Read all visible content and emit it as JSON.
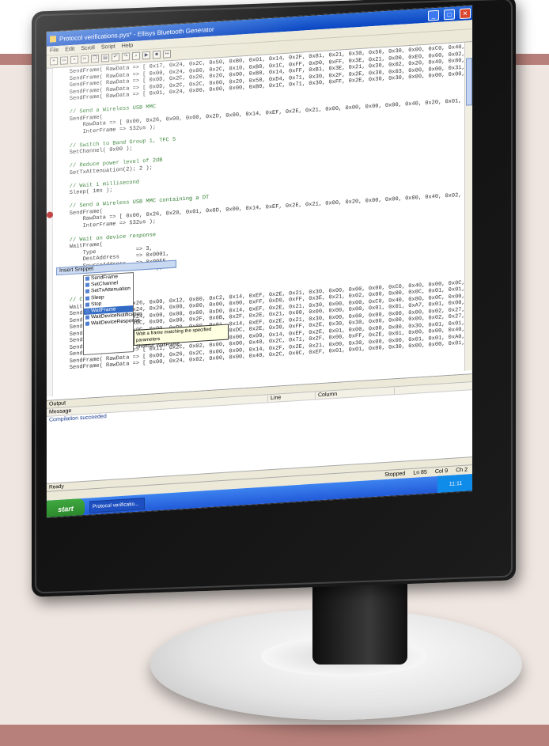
{
  "window": {
    "title": "Protocol verifications.pys* - Ellisys Bluetooth Generator",
    "min_symbol": "_",
    "max_symbol": "□",
    "close_symbol": "✕"
  },
  "menu": [
    "File",
    "Edit",
    "Scroll",
    "Script",
    "Help"
  ],
  "toolbar_icons": [
    "new-icon",
    "open-icon",
    "save-icon",
    "cut-icon",
    "copy-icon",
    "paste-icon",
    "undo-icon",
    "redo-icon",
    "find-icon",
    "run-icon",
    "stop-icon",
    "step-icon"
  ],
  "code_lines": [
    "    SendFrame( RawData => [ 0x17, 0x24, 0x2C, 0x50, 0xB0, 0x01, 0x14, 0x2F, 0x81, 0x21, 0x30, 0x50, 0x30, 0x00, 0xC0, 0x40, 0x00, 0x00, 0x00, 0xC0,",
    "    SendFrame( RawData => [ 0x00, 0x24, 0x00, 0x2C, 0x10, 0xB0, 0x1C, 0xFF, 0xD0, 0xFF, 0x3E, 0x21, 0xD0, 0xE0, 0x60, 0x02, 0x01, 0x01, 0xA7, 0x02, 0x00,",
    "    SendFrame( RawData => [ 0x0D, 0x2C, 0x20, 0x20, 0x00, 0xB0, 0x14, 0xFF, 0xB1, 0x3E, 0x21, 0x30, 0x02, 0x20, 0x40, 0x80, 0x00, 0x02, 0x27, 0x00,",
    "    SendFrame( RawData => [ 0x0D, 0x2C, 0x2C, 0x00, 0x20, 0x50, 0xD4, 0x71, 0x30, 0x2F, 0x2E, 0x30, 0x03, 0x00, 0x00, 0x31, 0x01, 0x5C, 0x02, 0x00,",
    "    SendFrame( RawData => [ 0x01, 0x24, 0x00, 0x00, 0x00, 0xB0, 0x1C, 0x71, 0x30, 0xFF, 0x2E, 0x30, 0x30, 0x00, 0x00, 0x00,",
    "",
    "    // Send a Wireless USB MMC",
    "    SendFrame(",
    "        RawData => [ 0x00, 0x26, 0x00, 0x00, 0x2D, 0x00, 0x14, 0xEF, 0x2E, 0x21, 0x00, 0x00, 0x00, 0x00, 0x40, 0x20, 0x01, 0x0C, 0x00, 0x0C, 0x2F, C",
    "        InterFrame => 532us );",
    "",
    "    // Switch to Band Group 1, TFC 5",
    "    SetChannel( 0x00 );",
    "",
    "    // Reduce power level of 2dB",
    "    SetTxAttenuation(2); 2 );",
    "",
    "    // Wait 1 millisecond",
    "    Sleep( 1ms );",
    "",
    "    // Send a Wireless USB MMC containing a DT",
    "    SendFrame(",
    "        RawData => [ 0x00, 0x26, 0x20, 0x01, 0x0D, 0x00, 0x14, 0xEF, 0x2E, 0x21, 0x00, 0x20, 0x00, 0x00, 0x00, 0x40, 0x02, 0x0C, 0x00, 0x0C, 0x5E, C",
    "        InterFrame => 532us );",
    "",
    "    // Wait on device response",
    "    WaitFrame(",
    "        Type            => 3,",
    "        DestAddress     => 0x0001,",
    "        SourceAddress   => 0x00FF,",
    "        Timeout         => 1s );",
    "",
    "",
    "",
    "    // Cond",
    "    WaitFrame         0x26, 0x00, 0x12, 0x00, 0xC2, 0x14, 0xEF, 0x2E, 0x21, 0x30, 0x00, 0x00, 0x00, 0xC0, 0x40, 0x00, 0x0C, 0x00, 0x00,",
    "    SendFrame         0x24, 0x20, 0x00, 0x00, 0x00, 0x00, 0xFF, 0xD0, 0xFF, 0x3E, 0x21, 0x02, 0x00, 0x00, 0x0C, 0x01, 0x01, 0xA7, 0x02, 0x00,",
    "    SendFrame         0x24, 0x00, 0x00, 0x00, 0xD0, 0x14, 0xEF, 0x2E, 0x21, 0x30, 0x00, 0x00, 0xC0, 0x40, 0x80, 0x0C, 0x00, 0x00, 0x00,",
    "    SendFrame         0x0C, 0x00, 0x00, 0x2F, 0x0B, 0x2F, 0x2E, 0x21, 0x00, 0x00, 0x00, 0x00, 0x01, 0x01, 0xA7, 0x01, 0x00,",
    "    SendFrame         0x0C, 0x00, 0xD0, 0x00, 0x01, 0x14, 0xEF, 0x2E, 0x21, 0x30, 0x00, 0x00, 0x00, 0x00, 0x00, 0x02, 0x27, 0x00,",
    "    SendFrame         0x26, 0x00, 0x02, 0x00, 0x00, 0xDC, 0x2E, 0x30, 0xFF, 0x2E, 0x30, 0x30, 0x00, 0x00, 0x00, 0x02, 0x27, 0x00,",
    "    SendFrame( RawData => [ 0x00, 0x26, 0x20, 0x00, 0x00, 0x00, 0x14, 0xEF, 0x2E, 0x01, 0x00, 0x00, 0x80, 0x30, 0x01, 0x01, 0x02, 0x00, 0x00,",
    "    SendFrame( RawData => [ 0x11, 0x2C, 0x02, 0x00, 0x00, 0x40, 0x2C, 0x71, 0x2F, 0x00, 0xFF, 0x2E, 0x01, 0x00, 0x00, 0x40, 0x00, 0x00, 0x00,",
    "    SendFrame( RawData => [ 0x00, 0x26, 0x2C, 0x00, 0x00, 0x14, 0x2F, 0x2E, 0x21, 0x00, 0x30, 0x00, 0x00, 0x01, 0x01, 0xA0, 0x02, 0x00,",
    "    SendFrame( RawData => [ 0x00, 0x24, 0x02, 0x00, 0x00, 0x40, 0x2C, 0x0C, 0xEF, 0x01, 0x01, 0x00, 0x30, 0x00, 0x00, 0x01, 0x01, 0xA7, 0x02, 0x00,"
  ],
  "snippet": {
    "header": "Insert Snippet",
    "items": [
      "SendFrame",
      "SetChannel",
      "SetTxAttenuation",
      "Sleep",
      "Stop",
      "WaitFrame",
      "WaitDeviceNotification",
      "WaitDeviceResponse"
    ],
    "selected": "WaitFrame",
    "tooltip_line1": "Wait a frame matching the specified parameters",
    "tooltip_line2": "Shortcut: WaitFrame"
  },
  "output": {
    "header": "Output",
    "columns": [
      "Message",
      "Line",
      "Column"
    ],
    "message": "Compilation succeeded"
  },
  "ready_text": "Ready",
  "status": {
    "state": "Stopped",
    "line": "Ln 85",
    "col": "Col 9",
    "ch": "Ch 2"
  },
  "taskbar": {
    "start": "start",
    "task": "Protocol verificatio...",
    "clock": "11:11"
  }
}
